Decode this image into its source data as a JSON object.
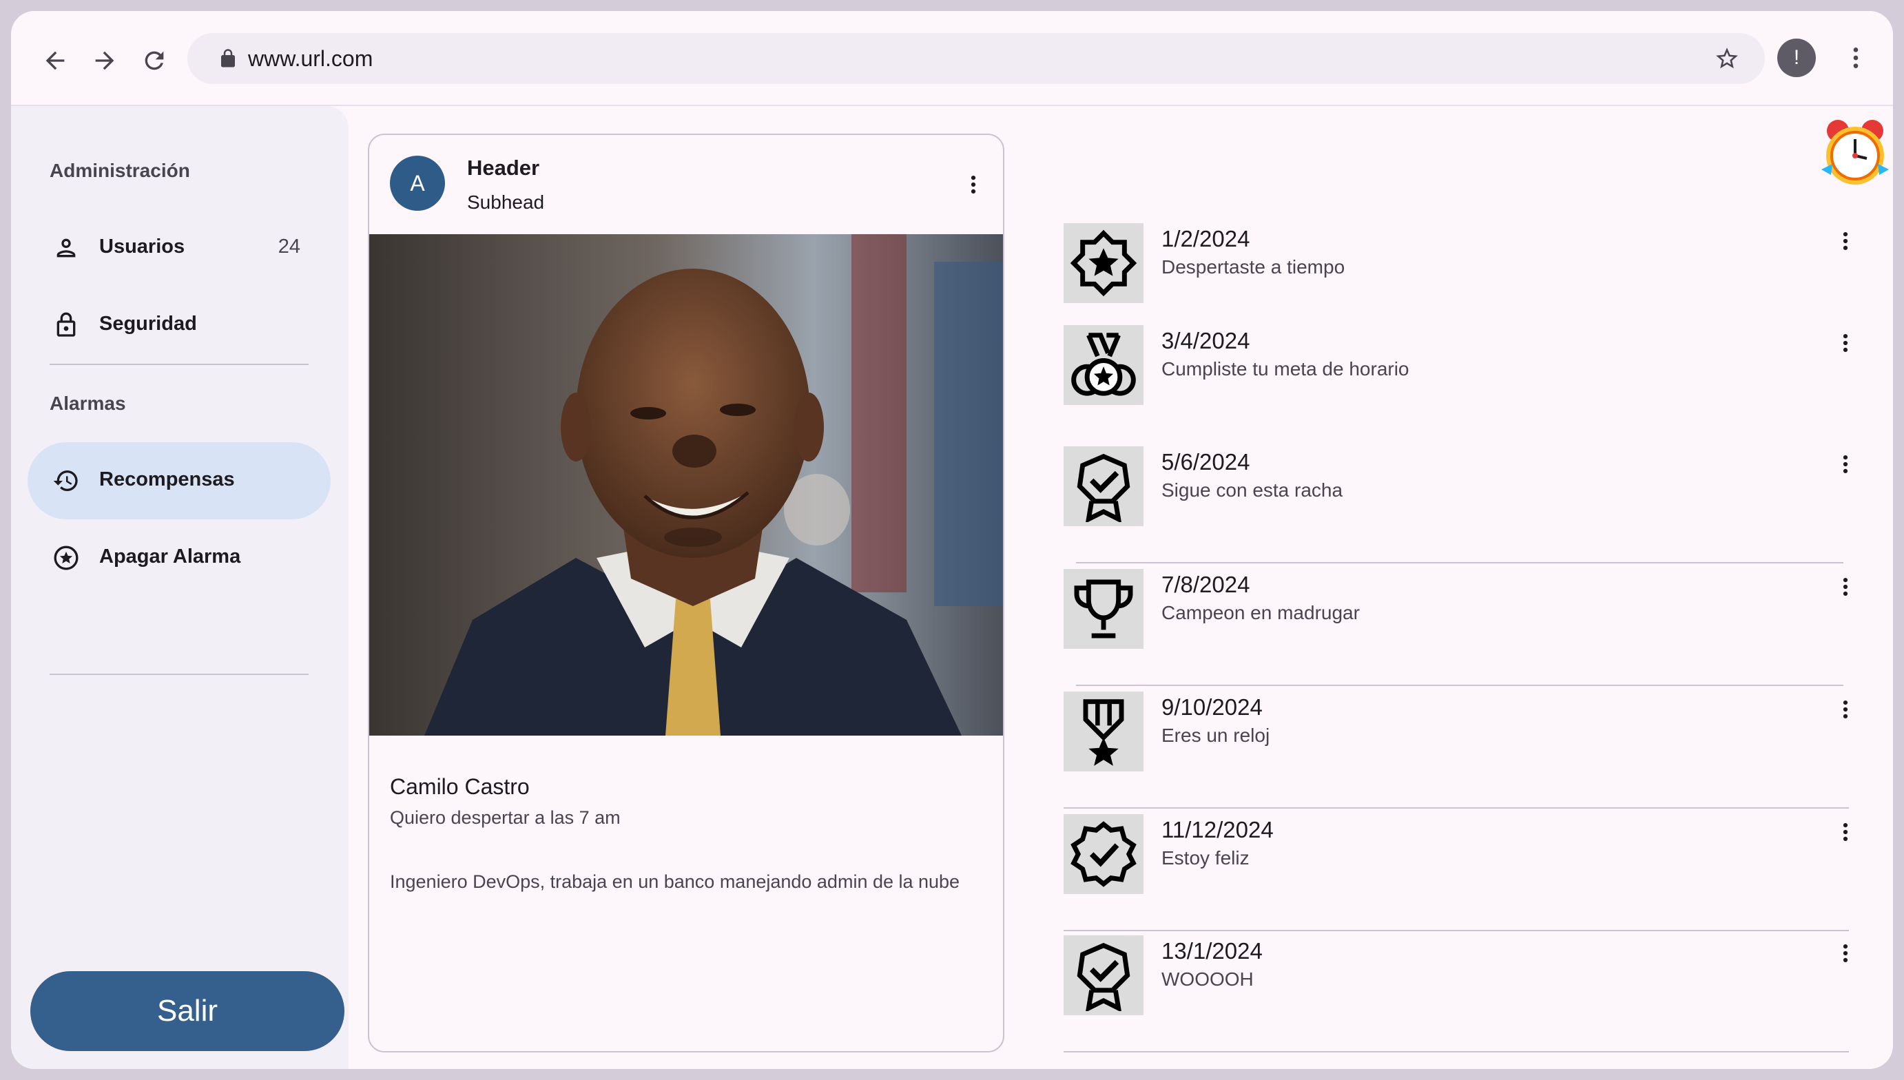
{
  "browser": {
    "url": "www.url.com",
    "profile_initial": "!"
  },
  "sidebar": {
    "section_admin": "Administración",
    "items_admin": [
      {
        "label": "Usuarios",
        "badge": "24",
        "icon": "person-icon"
      },
      {
        "label": "Seguridad",
        "icon": "lock-icon"
      }
    ],
    "section_alarms": "Alarmas",
    "items_alarms": [
      {
        "label": "Recompensas",
        "icon": "history-icon",
        "active": true
      },
      {
        "label": "Apagar Alarma",
        "icon": "star-circle-icon"
      }
    ],
    "logout_label": "Salir"
  },
  "card": {
    "avatar_letter": "A",
    "header": "Header",
    "subhead": "Subhead",
    "name": "Camilo Castro",
    "tagline": "Quiero despertar a las 7 am",
    "bio": "Ingeniero DevOps, trabaja en un banco manejando admin de la nube"
  },
  "rewards": [
    {
      "date": "1/2/2024",
      "message": "Despertaste a tiempo",
      "icon": "star-badge-icon"
    },
    {
      "date": "3/4/2024",
      "message": "Cumpliste tu meta de horario",
      "icon": "medal-icon"
    },
    {
      "date": "5/6/2024",
      "message": "Sigue con esta racha",
      "icon": "check-ribbon-icon"
    },
    {
      "date": "7/8/2024",
      "message": "Campeon en madrugar",
      "icon": "trophy-icon"
    },
    {
      "date": "9/10/2024",
      "message": "Eres un reloj",
      "icon": "military-medal-icon"
    },
    {
      "date": "11/12/2024",
      "message": "Estoy feliz",
      "icon": "verified-badge-icon"
    },
    {
      "date": "13/1/2024",
      "message": "WOOOOH",
      "icon": "check-ribbon-icon"
    }
  ],
  "colors": {
    "primary": "#355f8c",
    "active_nav": "#d8e4f5",
    "sidebar_bg": "#f2f0f6"
  }
}
